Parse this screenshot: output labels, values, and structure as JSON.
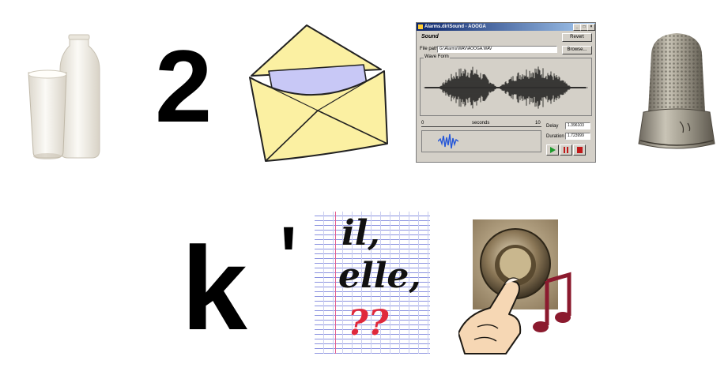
{
  "row1": {
    "digit": "2",
    "sound_window": {
      "title": "Alarms.dir\\Sound - AOOGA",
      "heading": "Sound",
      "revert_label": "Revert",
      "path_label": "File path",
      "path_value": "G:\\Alarms\\WAV\\AOOGA.WAV",
      "browse_label": "Browse...",
      "waveform_label": "Wave Form",
      "scale_start": "0",
      "scale_unit": "seconds",
      "scale_end": "10",
      "delay_label": "Delay",
      "delay_value": "1.396103",
      "duration_label": "Duration",
      "duration_value": "1.723999"
    }
  },
  "row2": {
    "letter": "k",
    "apostrophe": "'",
    "notebook_lines": [
      "il,",
      "elle,",
      "??"
    ]
  },
  "colors": {
    "envelope_fill": "#fbf0a2",
    "envelope_letter": "#c8c8f6",
    "notebook_red": "#e0283c",
    "music_note": "#8b1a2e"
  }
}
